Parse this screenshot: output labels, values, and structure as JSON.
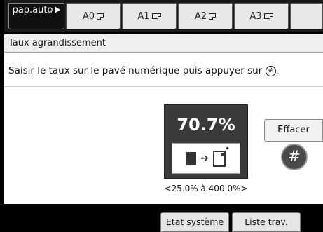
{
  "tabs": [
    {
      "label": "pap.auto",
      "icon": "play-triangle-icon",
      "active": true
    },
    {
      "label": "A0",
      "icon": "paper-portrait-icon"
    },
    {
      "label": "A1",
      "icon": "paper-landscape-icon"
    },
    {
      "label": "A2",
      "icon": "paper-portrait-icon"
    },
    {
      "label": "A3",
      "icon": "paper-landscape-icon"
    }
  ],
  "panel": {
    "title": "Taux agrandissement",
    "instruction": "Saisir le taux sur le pavé numérique puis appuyer sur",
    "instruction_end": "."
  },
  "ratio": {
    "value": "70.7%",
    "range": "<25.0% à 400.0%>"
  },
  "buttons": {
    "clear": "Effacer",
    "hash": "#"
  },
  "bottom_bar": {
    "status": "Etat système",
    "jobs": "Liste trav."
  }
}
